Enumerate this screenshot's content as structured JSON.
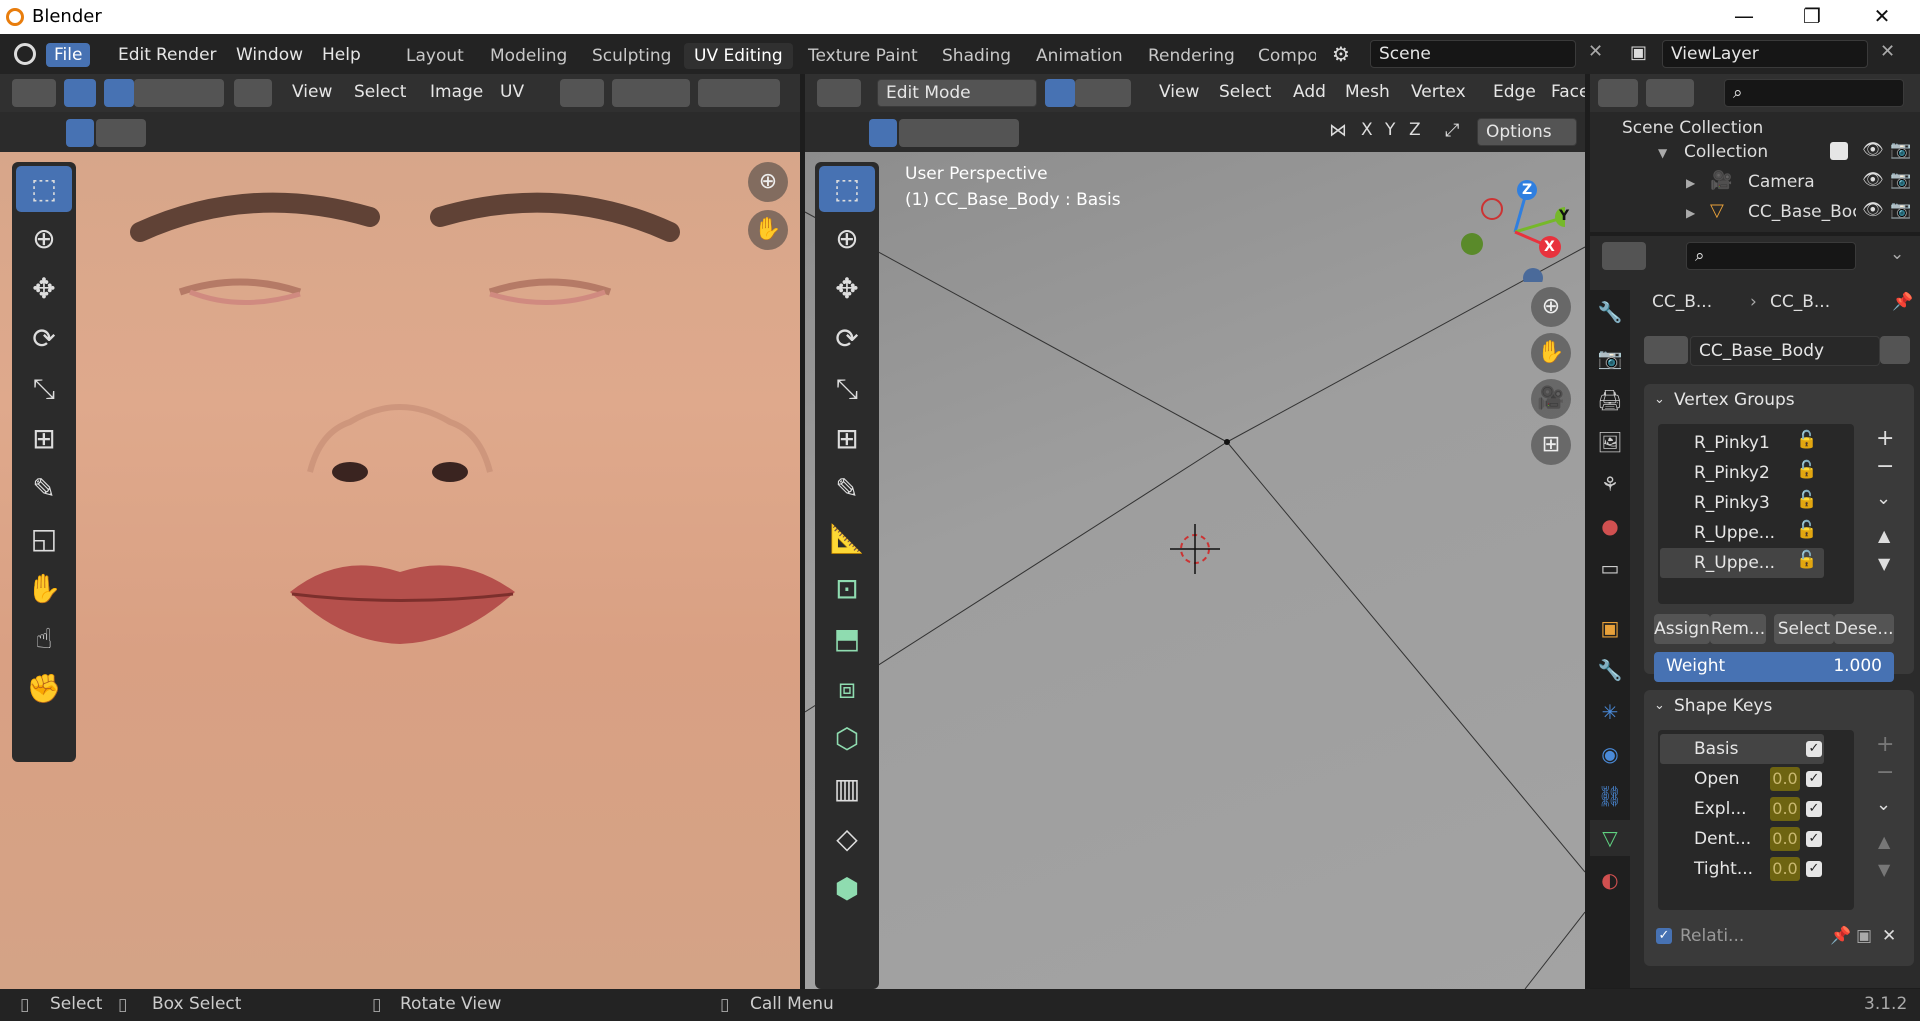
{
  "app": {
    "title": "Blender",
    "version": "3.1.2"
  },
  "window_controls": {
    "minimize": "—",
    "restore": "❐",
    "close": "✕"
  },
  "menus": [
    "File",
    "Edit",
    "Render",
    "Window",
    "Help"
  ],
  "workspaces": [
    "Layout",
    "Modeling",
    "Sculpting",
    "UV Editing",
    "Texture Paint",
    "Shading",
    "Animation",
    "Rendering",
    "Compo"
  ],
  "active_workspace": "UV Editing",
  "scene": {
    "name": "Scene"
  },
  "view_layer": {
    "name": "ViewLayer"
  },
  "uv_editor": {
    "header_menus": [
      "View",
      "Select",
      "Image",
      "UV"
    ]
  },
  "viewport": {
    "mode": "Edit Mode",
    "header_menus": [
      "View",
      "Select",
      "Add",
      "Mesh",
      "Vertex",
      "Edge",
      "Face"
    ],
    "axes": [
      "X",
      "Y",
      "Z"
    ],
    "options_label": "Options",
    "overlay_title": "User Perspective",
    "overlay_object": "(1) CC_Base_Body : Basis",
    "gizmo": {
      "x": "X",
      "y": "Y",
      "z": "Z"
    }
  },
  "outliner": {
    "root": "Scene Collection",
    "items": [
      {
        "label": "Collection"
      },
      {
        "label": "Camera"
      },
      {
        "label": "CC_Base_Boc"
      }
    ]
  },
  "properties": {
    "breadcrumb": [
      "CC_B...",
      "CC_B..."
    ],
    "mesh_name": "CC_Base_Body",
    "vertex_groups": {
      "title": "Vertex Groups",
      "items": [
        "R_Pinky1",
        "R_Pinky2",
        "R_Pinky3",
        "R_Uppe...",
        "R_Uppe..."
      ],
      "assign": "Assign",
      "remove": "Rem...",
      "select": "Select",
      "deselect": "Dese...",
      "weight_label": "Weight",
      "weight_value": "1.000"
    },
    "shape_keys": {
      "title": "Shape Keys",
      "items": [
        {
          "name": "Basis",
          "value": ""
        },
        {
          "name": "Open",
          "value": "0.0"
        },
        {
          "name": "Expl...",
          "value": "0.0"
        },
        {
          "name": "Dent...",
          "value": "0.0"
        },
        {
          "name": "Tight...",
          "value": "0.0"
        }
      ],
      "relative": "Relati..."
    }
  },
  "statusbar": {
    "select": "Select",
    "box_select": "Box Select",
    "rotate": "Rotate View",
    "menu": "Call Menu"
  },
  "colors": {
    "accent": "#4772b3",
    "header": "#303030",
    "bg": "#1d1d1d"
  }
}
